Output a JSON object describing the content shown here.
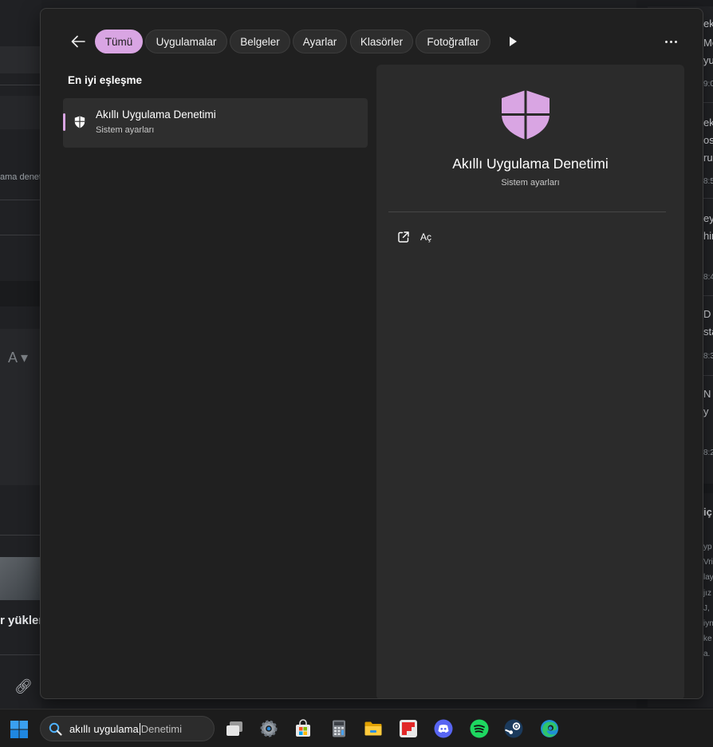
{
  "flyout": {
    "filters": [
      {
        "label": "Tümü",
        "active": true
      },
      {
        "label": "Uygulamalar",
        "active": false
      },
      {
        "label": "Belgeler",
        "active": false
      },
      {
        "label": "Ayarlar",
        "active": false
      },
      {
        "label": "Klasörler",
        "active": false
      },
      {
        "label": "Fotoğraflar",
        "active": false
      }
    ],
    "best_match_heading": "En iyi eşleşme",
    "best_match": {
      "title": "Akıllı Uygulama Denetimi",
      "subtitle": "Sistem ayarları"
    },
    "detail": {
      "title": "Akıllı Uygulama Denetimi",
      "subtitle": "Sistem ayarları",
      "actions": [
        {
          "label": "Aç",
          "icon": "open-external-icon"
        }
      ]
    }
  },
  "taskbar": {
    "search_typed": "akıllı uygulama",
    "search_suggestion": "Denetimi",
    "icons": [
      "task-view-icon",
      "settings-icon",
      "store-icon",
      "calculator-icon",
      "file-explorer-icon",
      "flipboard-icon",
      "discord-icon",
      "spotify-icon",
      "steam-icon",
      "edge-icon"
    ]
  },
  "background": {
    "left_fragments": [
      "ama denet",
      "r yükler"
    ],
    "right_fragments": [
      "ek",
      "Me",
      "yu",
      "9:0",
      "ek",
      "os",
      "ru",
      "8:5",
      "ey",
      "hir",
      "8:4",
      "D",
      "sta",
      "8:3",
      "N",
      "y",
      "8:2",
      "iç",
      "yp",
      "Vri",
      "lay",
      "jız",
      "J,",
      "iyn",
      "ke",
      "a."
    ]
  },
  "colors": {
    "accent": "#d9a5e3",
    "flyout_bg": "#202020",
    "detail_bg": "#2b2b2b"
  }
}
